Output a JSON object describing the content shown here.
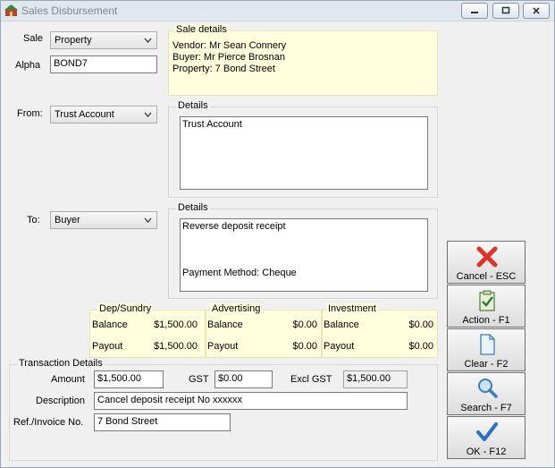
{
  "window": {
    "title": "Sales Disbursement",
    "min": "▭",
    "max": "▣",
    "close": "✕"
  },
  "sale": {
    "label": "Sale",
    "value": "Property",
    "alpha_label": "Alpha",
    "alpha_value": "BOND7"
  },
  "sale_details": {
    "legend": "Sale details",
    "vendor": "Vendor: Mr Sean Connery",
    "buyer": "Buyer: Mr Pierce Brosnan",
    "property": "Property: 7 Bond Street"
  },
  "from": {
    "label": "From:",
    "value": "Trust Account",
    "details_legend": "Details",
    "details_text": "Trust Account"
  },
  "to": {
    "label": "To:",
    "value": "Buyer",
    "details_legend": "Details",
    "details_line1": "Reverse deposit receipt",
    "details_line2": "Payment Method: Cheque"
  },
  "balances": [
    {
      "title": "Dep/Sundry",
      "balance_label": "Balance",
      "balance": "$1,500.00",
      "payout_label": "Payout",
      "payout": "$1,500.00"
    },
    {
      "title": "Advertising",
      "balance_label": "Balance",
      "balance": "$0.00",
      "payout_label": "Payout",
      "payout": "$0.00"
    },
    {
      "title": "Investment",
      "balance_label": "Balance",
      "balance": "$0.00",
      "payout_label": "Payout",
      "payout": "$0.00"
    }
  ],
  "transaction": {
    "legend": "Transaction Details",
    "amount_label": "Amount",
    "amount": "$1,500.00",
    "gst_label": "GST",
    "gst": "$0.00",
    "excl_label": "Excl GST",
    "excl": "$1,500.00",
    "desc_label": "Description",
    "desc": "Cancel deposit receipt No xxxxxx",
    "ref_label": "Ref./Invoice No.",
    "ref": "7 Bond Street"
  },
  "buttons": {
    "cancel": "Cancel - ESC",
    "action": "Action - F1",
    "clear": "Clear - F2",
    "search": "Search - F7",
    "ok": "OK - F12"
  },
  "colors": {
    "panel_yellow": "#fffedd",
    "cancel_red": "#e0302a",
    "ok_blue": "#2b6fc7"
  }
}
